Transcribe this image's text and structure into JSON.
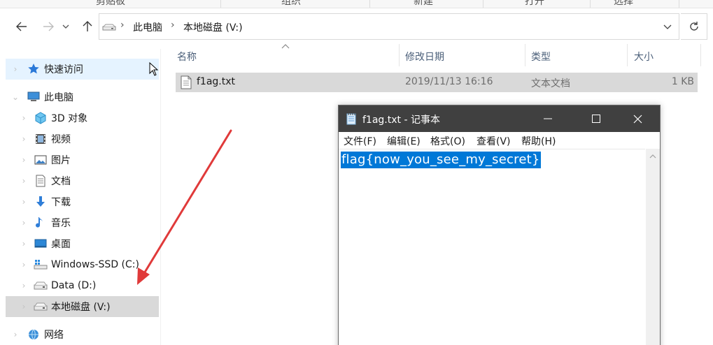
{
  "ribbon": {
    "groups": [
      "剪贴板",
      "组织",
      "新建",
      "打开",
      "选择"
    ]
  },
  "address_bar": {
    "crumbs": [
      "此电脑",
      "本地磁盘 (V:)"
    ]
  },
  "sidebar": {
    "items": [
      {
        "label": "快速访问",
        "icon": "star-pin-icon",
        "state": "hover"
      },
      {
        "label": "此电脑",
        "icon": "computer-icon",
        "state": ""
      },
      {
        "label": "3D 对象",
        "icon": "cube-3d-icon",
        "state": ""
      },
      {
        "label": "视频",
        "icon": "video-icon",
        "state": ""
      },
      {
        "label": "图片",
        "icon": "picture-icon",
        "state": ""
      },
      {
        "label": "文档",
        "icon": "document-icon",
        "state": ""
      },
      {
        "label": "下载",
        "icon": "download-arrow-icon",
        "state": ""
      },
      {
        "label": "音乐",
        "icon": "music-note-icon",
        "state": ""
      },
      {
        "label": "桌面",
        "icon": "desktop-icon",
        "state": ""
      },
      {
        "label": "Windows-SSD (C:)",
        "icon": "windows-drive-icon",
        "state": ""
      },
      {
        "label": "Data (D:)",
        "icon": "drive-icon",
        "state": ""
      },
      {
        "label": "本地磁盘 (V:)",
        "icon": "drive-icon",
        "state": "selected"
      },
      {
        "label": "网络",
        "icon": "network-icon",
        "state": ""
      }
    ]
  },
  "file_list": {
    "columns": [
      "名称",
      "修改日期",
      "类型",
      "大小"
    ],
    "rows": [
      {
        "name": "f1ag.txt",
        "modified": "2019/11/13 16:16",
        "type": "文本文档",
        "size": "1 KB"
      }
    ]
  },
  "notepad": {
    "title": "f1ag.txt - 记事本",
    "menu": [
      "文件(F)",
      "编辑(E)",
      "格式(O)",
      "查看(V)",
      "帮助(H)"
    ],
    "content": "flag{now_you_see_my_secret}",
    "selection_color": "#0078d7",
    "titlebar_color": "#404040"
  },
  "annotation": {
    "arrow_color": "#e03a3a"
  }
}
